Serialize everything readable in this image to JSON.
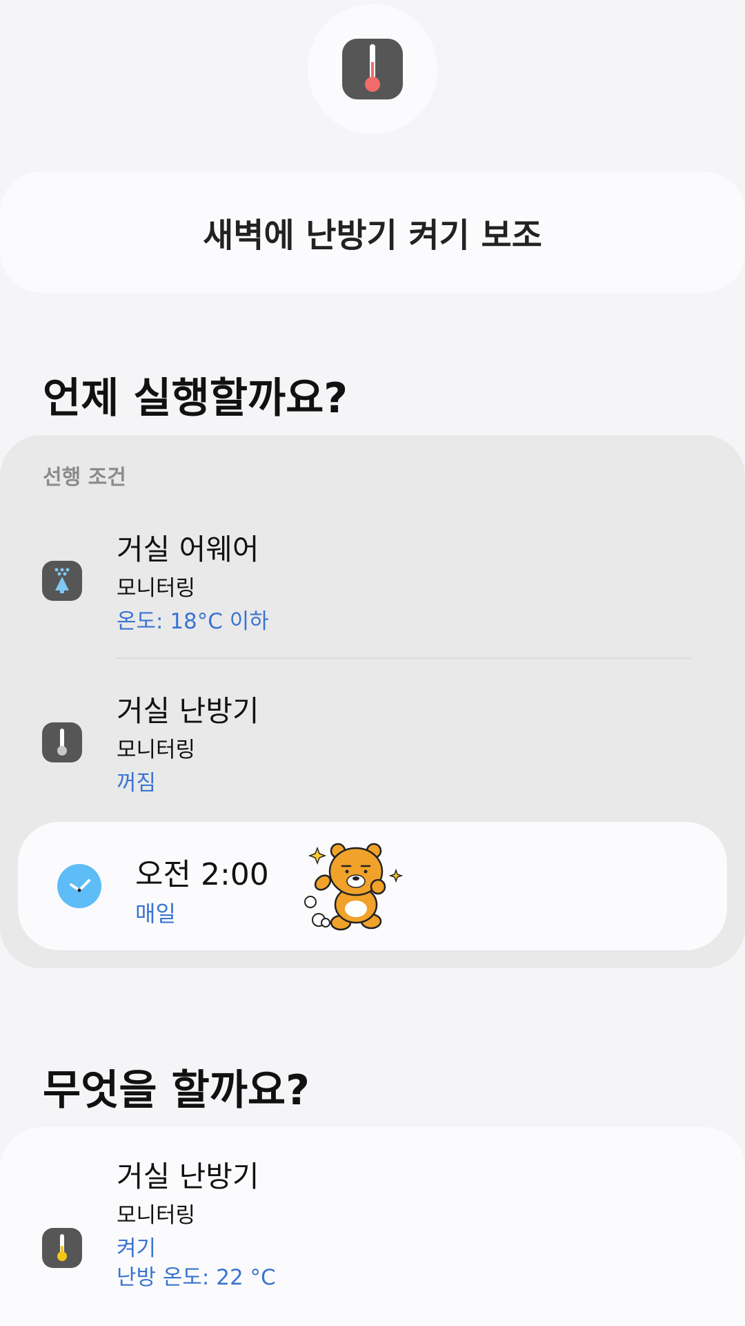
{
  "header": {
    "icon": "thermometer-icon",
    "routine_name": "새벽에 난방기 켜기 보조"
  },
  "when": {
    "section_title": "언제 실행할까요?",
    "precondition_label": "선행 조건",
    "conditions": [
      {
        "icon": "air-purifier-icon",
        "device": "거실 어웨어",
        "type": "모니터링",
        "value": "온도: 18°C 이하"
      },
      {
        "icon": "thermometer-icon",
        "device": "거실 난방기",
        "type": "모니터링",
        "value": "꺼짐"
      }
    ],
    "trigger": {
      "icon": "clock-icon",
      "time": "오전 2:00",
      "repeat": "매일"
    }
  },
  "what": {
    "section_title": "무엇을 할까요?",
    "actions": [
      {
        "icon": "thermometer-icon",
        "device": "거실 난방기",
        "type": "모니터링",
        "value": "켜기",
        "value2": "난방 온도: 22 °C"
      }
    ]
  },
  "colors": {
    "accent_text": "#3a74d0",
    "clock": "#5ebcf6",
    "thermo_red": "#f26b6b",
    "thermo_yellow": "#f5c518"
  }
}
